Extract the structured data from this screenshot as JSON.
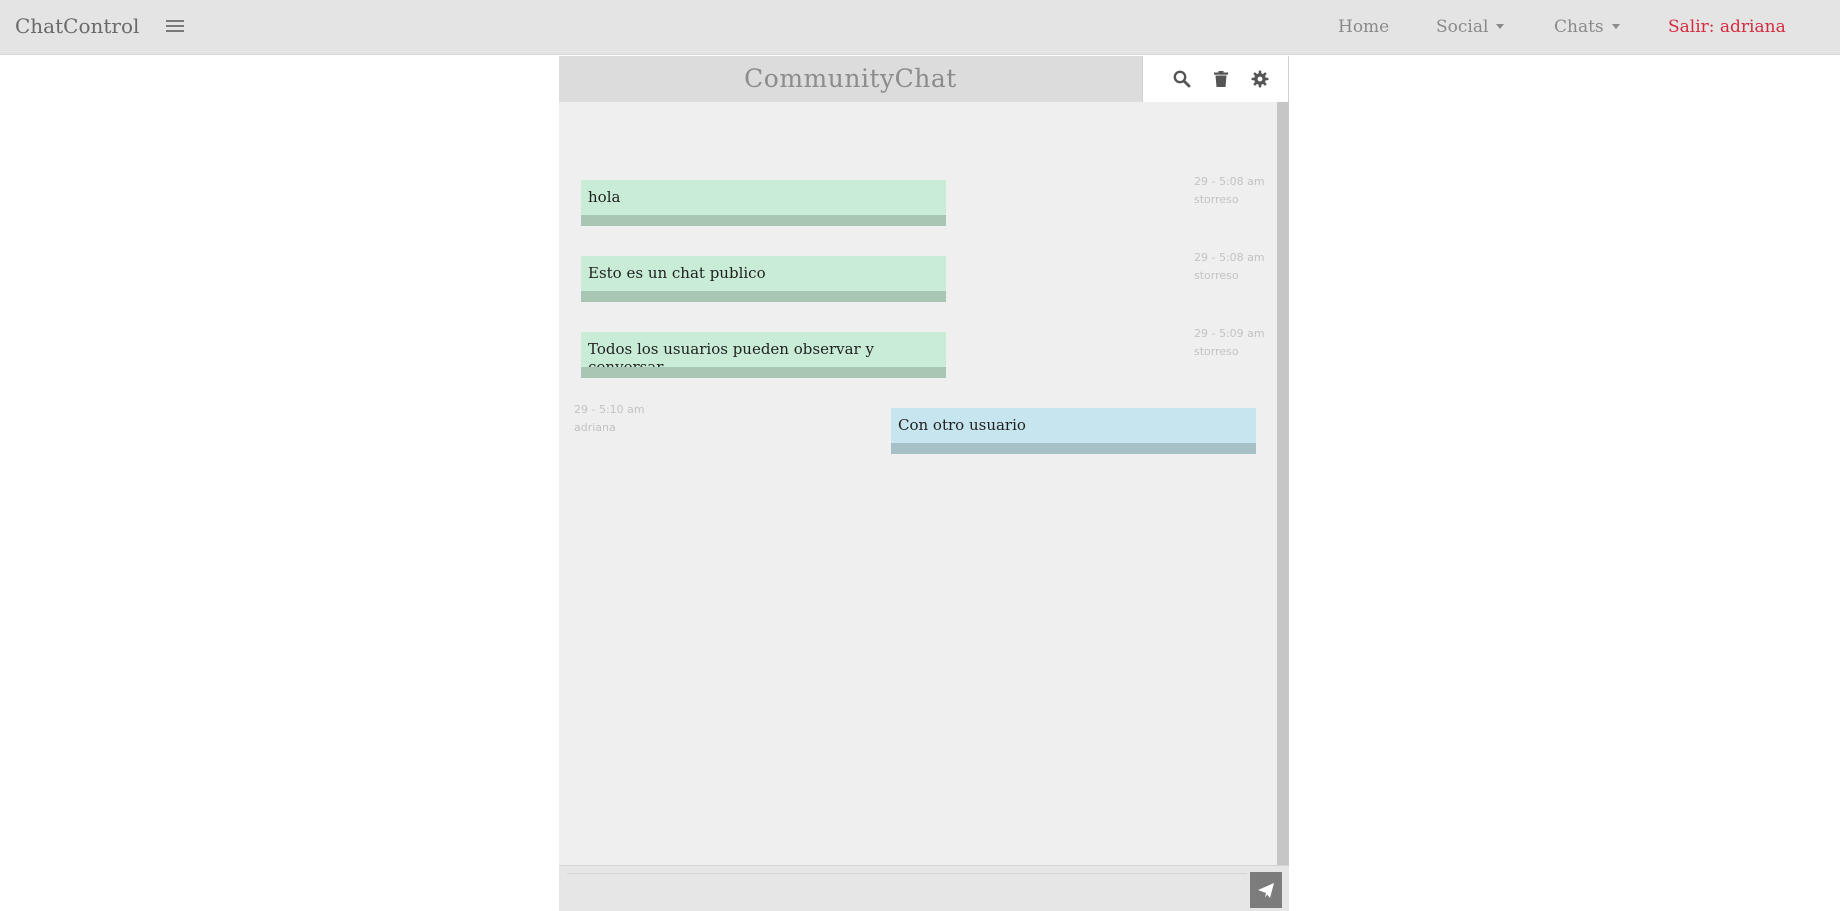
{
  "navbar": {
    "brand": "ChatControl",
    "links": {
      "home": "Home",
      "social": "Social",
      "chats": "Chats",
      "logout": "Salir: adriana"
    }
  },
  "chat": {
    "title": "CommunityChat",
    "tools": [
      "search-icon",
      "trash-icon",
      "gear-icon"
    ],
    "messages": [
      {
        "text": "hola",
        "time": "29 - 5:08 am",
        "user": "storreso",
        "side": "left"
      },
      {
        "text": "Esto es un chat publico",
        "time": "29 - 5:08 am",
        "user": "storreso",
        "side": "left"
      },
      {
        "text": "Todos los usuarios pueden observar y conversar",
        "time": "29 - 5:09 am",
        "user": "storreso",
        "side": "left"
      },
      {
        "text": "Con otro usuario",
        "time": "29 - 5:10 am",
        "user": "adriana",
        "side": "right"
      }
    ],
    "composer": {
      "value": "",
      "placeholder": ""
    }
  },
  "colors": {
    "navbar_bg": "#e4e4e4",
    "logout": "#d62c3f",
    "bubble_other": "#c9ecd6",
    "bubble_self": "#c6e5ee"
  }
}
